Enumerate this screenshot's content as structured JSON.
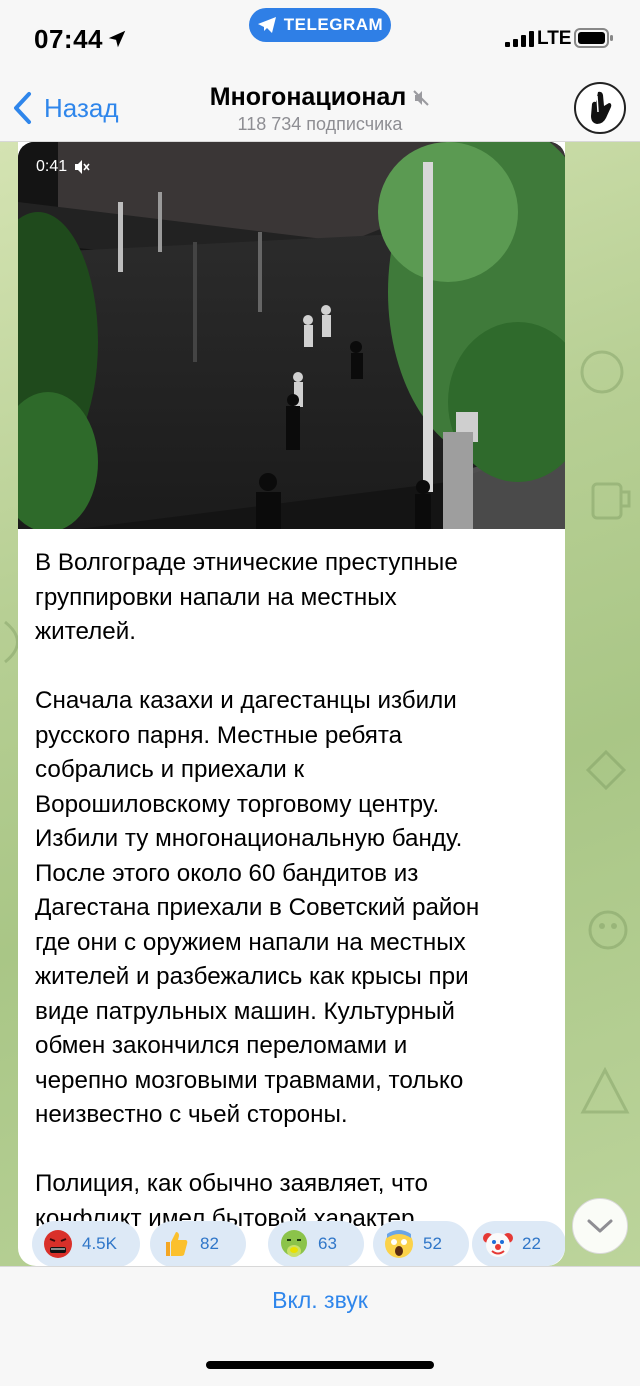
{
  "status_bar": {
    "time": "07:44",
    "app_pill": "TELEGRAM",
    "network": "LTE"
  },
  "header": {
    "back_label": "Назад",
    "channel_name": "Многонационал",
    "subscribers": "118 734 подписчика"
  },
  "post": {
    "video": {
      "duration": "0:41"
    },
    "paragraphs": [
      "В Волгограде этнические преступные\nгруппировки напали на местных\nжителей.",
      "Сначала казахи и дагестанцы избили\nрусского парня. Местные ребята\nсобрались и приехали к\nВорошиловскому торговому центру.\nИзбили ту многонациональную банду.\nПосле этого около 60 бандитов из\nДагестана приехали в Советский район\nгде они с оружием напали на местных\nжителей и разбежались как крысы при\nвиде патрульных машин. Культурный\nобмен закончился переломами и\nчерепно мозговыми травмами, только\nнеизвестно с чьей стороны.",
      "Полиция, как обычно заявляет, что\nконфликт имел бытовой характер."
    ],
    "reactions": [
      {
        "icon": "angry-face-icon",
        "count": "4.5K"
      },
      {
        "icon": "thumbs-up-icon",
        "count": "82"
      },
      {
        "icon": "nauseated-face-icon",
        "count": "63"
      },
      {
        "icon": "screaming-face-icon",
        "count": "52"
      },
      {
        "icon": "clown-face-icon",
        "count": "22"
      }
    ]
  },
  "bottom_bar": {
    "unmute_label": "Вкл. звук"
  },
  "colors": {
    "accent": "#2f86eb",
    "reaction_bg": "#dde9f6",
    "chat_bg": "#b7cf94",
    "telegram_pill": "#2f7fe6"
  }
}
